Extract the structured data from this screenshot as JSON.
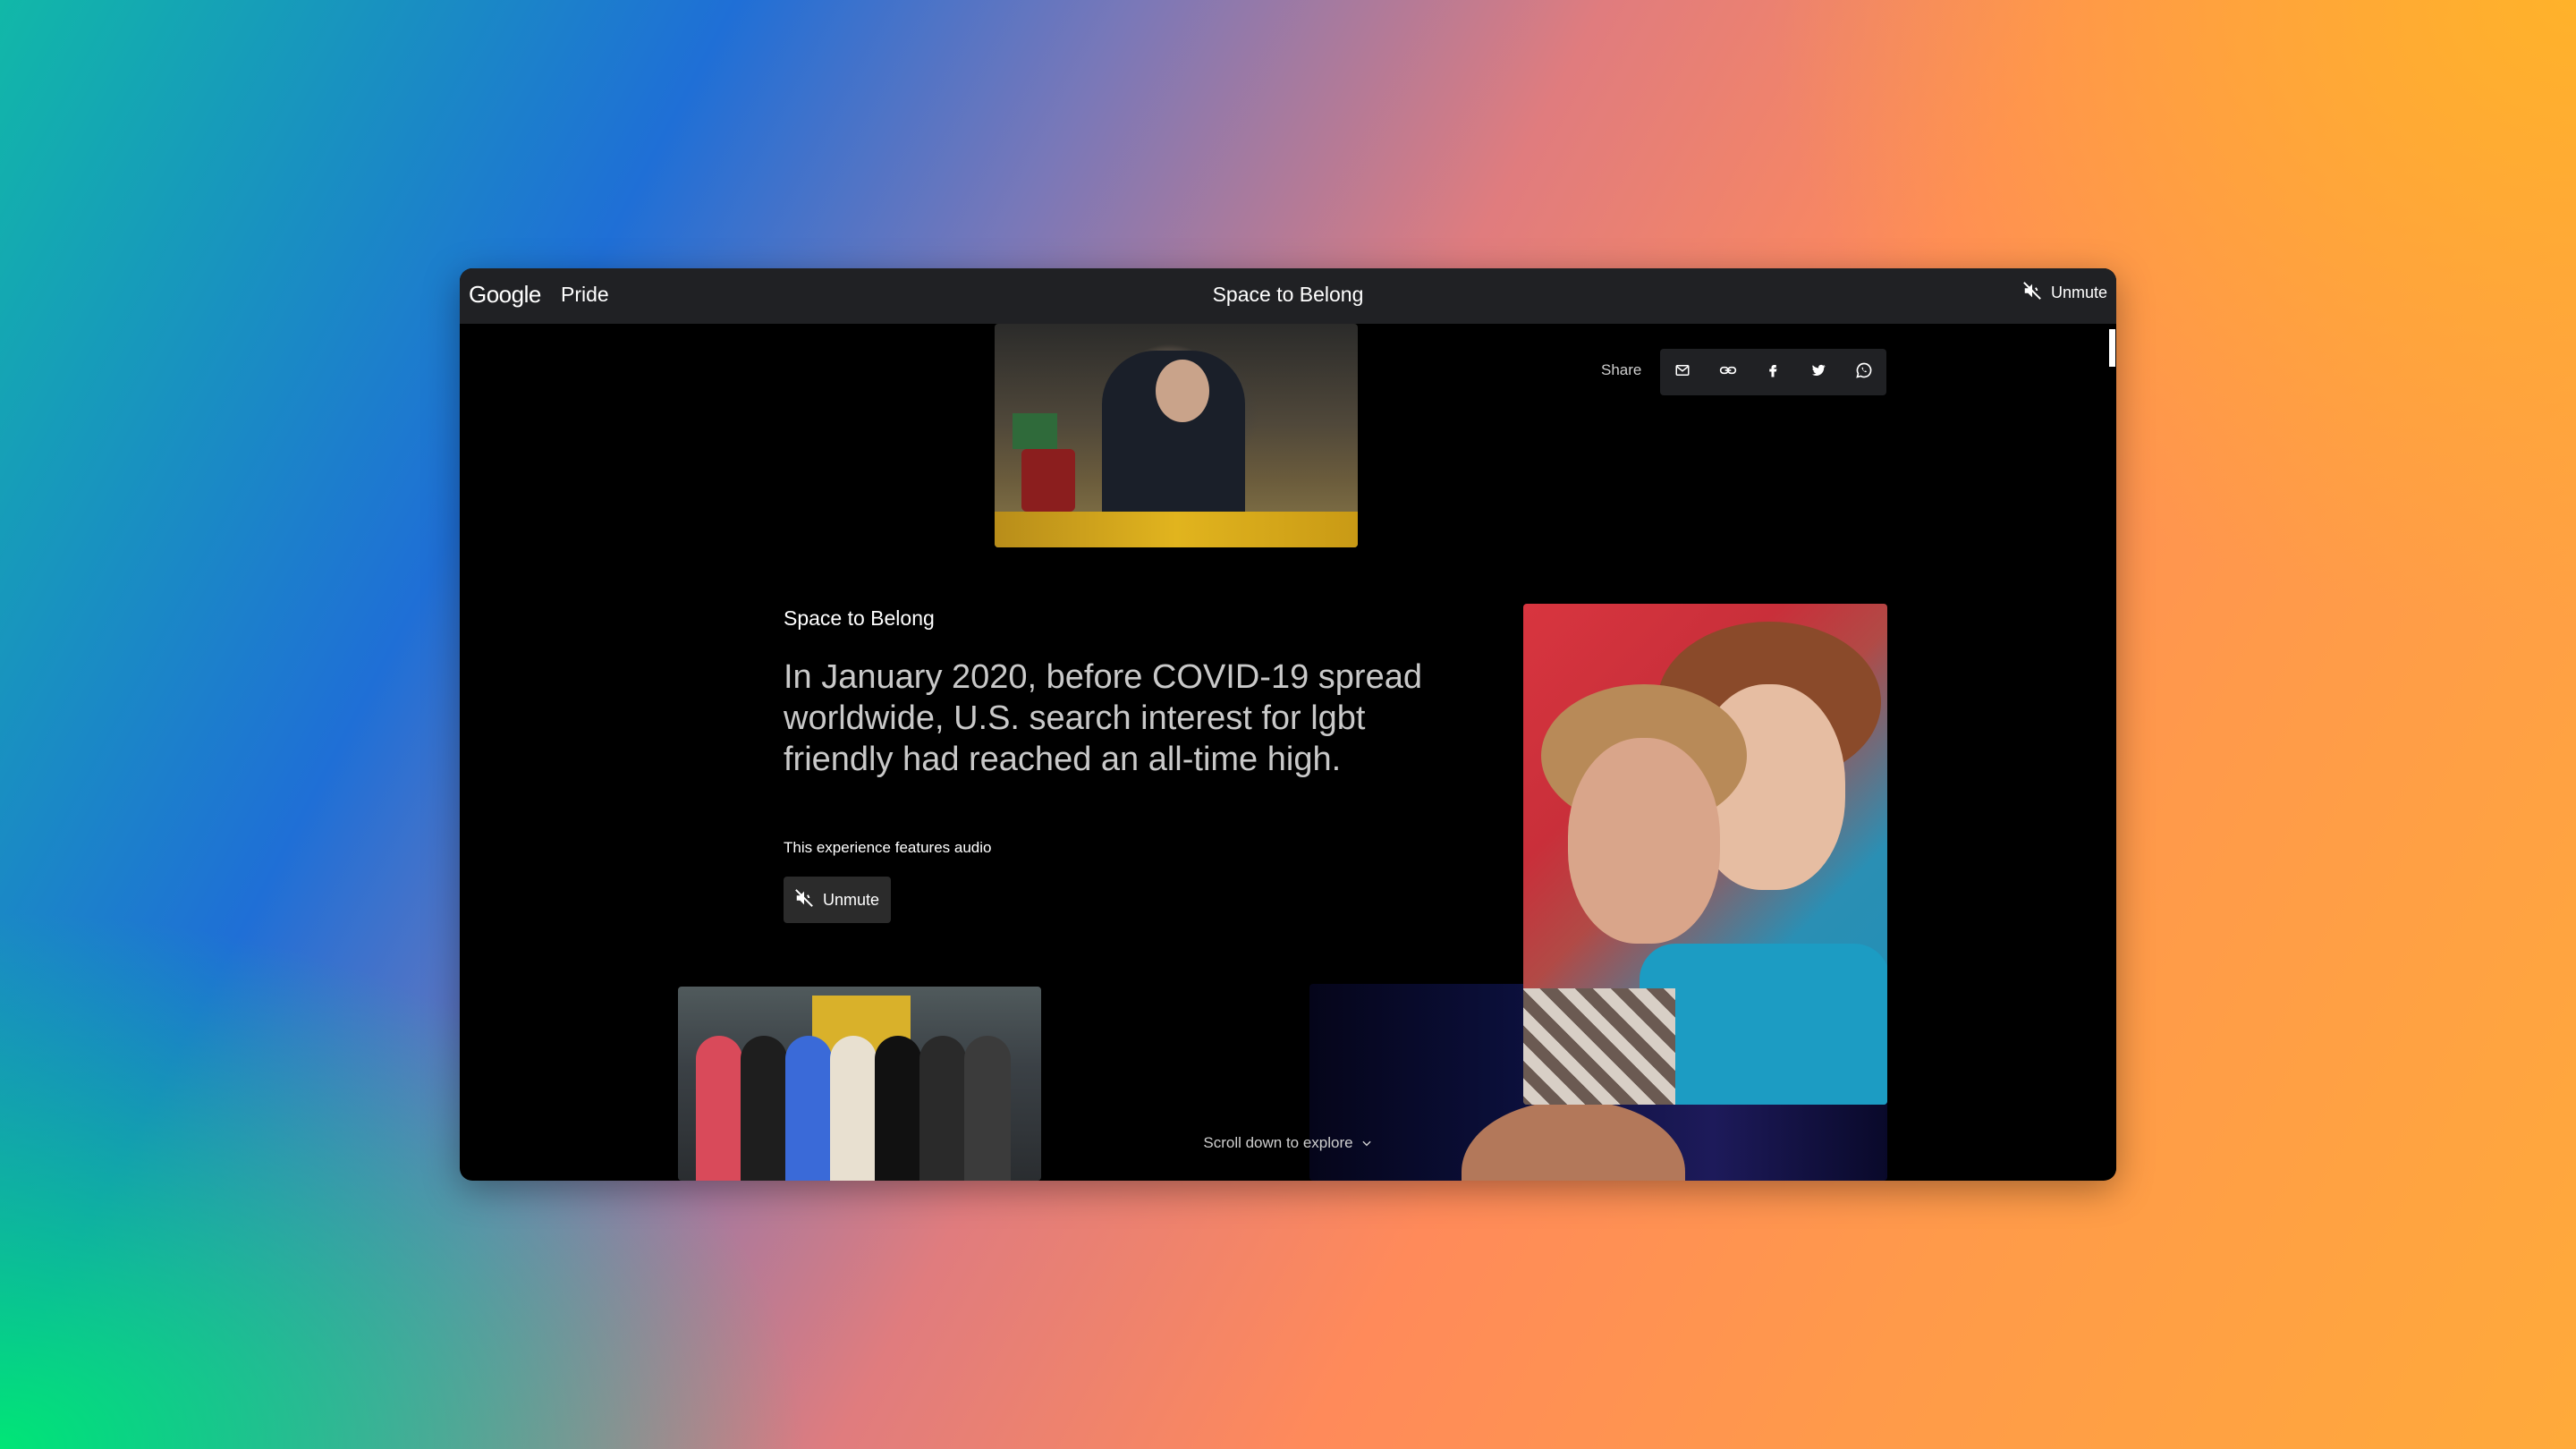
{
  "header": {
    "logo": "Google",
    "section": "Pride",
    "title": "Space to Belong",
    "unmute_label": "Unmute"
  },
  "share": {
    "label": "Share",
    "buttons": [
      "email-icon",
      "link-icon",
      "facebook-icon",
      "twitter-icon",
      "whatsapp-icon"
    ]
  },
  "main": {
    "section_label": "Space to Belong",
    "headline": "In January 2020, before COVID-19 spread worldwide, U.S. search interest for lgbt friendly had reached an all-time high.",
    "audio_note": "This experience features audio",
    "unmute_label": "Unmute",
    "scroll_hint": "Scroll down to explore"
  },
  "colors": {
    "topbar": "#202124",
    "page": "#000000",
    "text_primary": "#ffffff",
    "text_secondary": "#c9c9c9"
  }
}
